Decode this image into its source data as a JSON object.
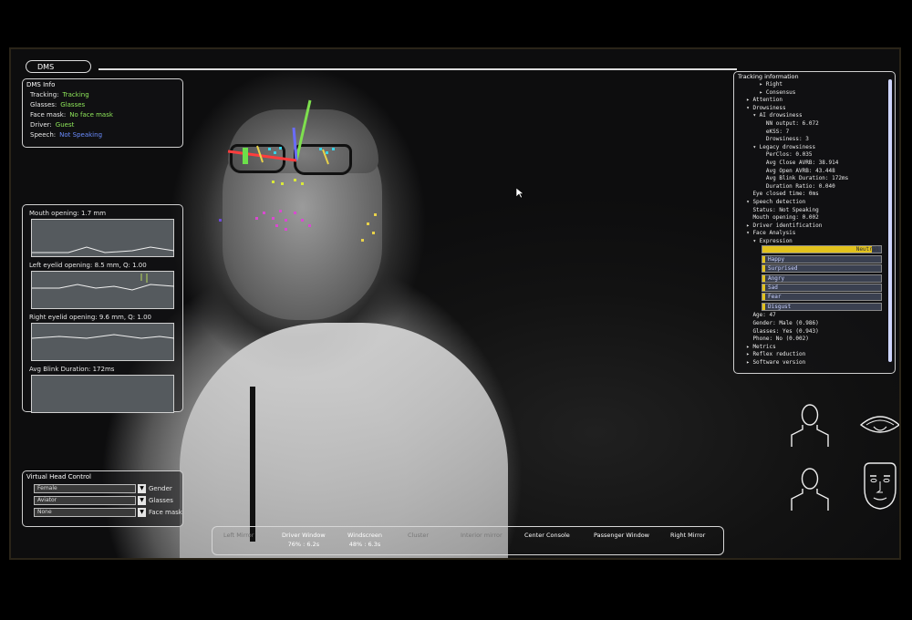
{
  "header": {
    "tab_label": "DMS"
  },
  "dms_info": {
    "title": "DMS Info",
    "rows": [
      {
        "key": "Tracking:",
        "value": "Tracking",
        "color": "#8fe85a"
      },
      {
        "key": "Glasses:",
        "value": "Glasses",
        "color": "#8fe85a"
      },
      {
        "key": "Face mask:",
        "value": "No face mask",
        "color": "#8fe85a"
      },
      {
        "key": "Driver:",
        "value": "Guest",
        "color": "#8fe85a"
      },
      {
        "key": "Speech:",
        "value": "Not Speaking",
        "color": "#6a8cff"
      }
    ]
  },
  "signals": {
    "mouth": "Mouth opening: 1.7 mm",
    "left_eyelid": "Left eyelid opening: 8.5 mm, Q: 1.00",
    "right_eyelid": "Right eyelid opening: 9.6 mm, Q: 1.00",
    "blink": "Avg Blink Duration: 172ms"
  },
  "tracking_info": {
    "title": "Tracking information",
    "rows": [
      "      ▸ Right",
      "      ▸ Consensus",
      "  ▸ Attention",
      "  ▾ Drowsiness",
      "    ▾ AI drowsiness",
      "        NN output: 6.072",
      "        eKSS: 7",
      "        Drowsiness: 3",
      "    ▾ Legacy drowsiness",
      "        PerClos: 0.035",
      "        Avg Close AVRB: 38.914",
      "        Avg Open AVRB: 43.448",
      "        Avg Blink Duration: 172ms",
      "        Duration Ratio: 0.040",
      "    Eye closed time: 0ms",
      "  ▾ Speech detection",
      "    Status: Not Speaking",
      "    Mouth opening: 0.002",
      "  ▸ Driver identification",
      "  ▾ Face Analysis",
      "    ▾ Expression"
    ],
    "expressions": [
      {
        "label": "Neutral",
        "value": 0.92
      },
      {
        "label": "Happy",
        "value": 0.02
      },
      {
        "label": "Surprised",
        "value": 0.02
      },
      {
        "label": "Angry",
        "value": 0.02
      },
      {
        "label": "Sad",
        "value": 0.02
      },
      {
        "label": "Fear",
        "value": 0.02
      },
      {
        "label": "Disgust",
        "value": 0.02
      }
    ],
    "rows_after": [
      "    Age: 47",
      "    Gender: Male (0.986)",
      "    Glasses: Yes (0.943)",
      "    Phone: No (0.002)",
      "  ▸ Metrics",
      "  ▸ Reflex reduction",
      "  ▸ Software version"
    ]
  },
  "virtual_head": {
    "title": "Virtual Head Control",
    "controls": [
      {
        "value": "Female",
        "label": "Gender"
      },
      {
        "value": "Aviator",
        "label": "Glasses"
      },
      {
        "value": "None",
        "label": "Face mask"
      }
    ]
  },
  "gaze_zones": [
    {
      "name": "Left Mirror",
      "value": "",
      "active": false
    },
    {
      "name": "Driver Window",
      "value": "76% : 6.2s",
      "active": true
    },
    {
      "name": "Windscreen",
      "value": "48% : 6.3s",
      "active": true
    },
    {
      "name": "Cluster",
      "value": "",
      "active": false
    },
    {
      "name": "Interior mirror",
      "value": "",
      "active": false
    },
    {
      "name": "Center Console",
      "value": "",
      "active": true
    },
    {
      "name": "Passenger Window",
      "value": "",
      "active": true
    },
    {
      "name": "Right Mirror",
      "value": "",
      "active": true
    }
  ],
  "colors": {
    "accent_green": "#8fe85a",
    "accent_blue": "#6a8cff",
    "expression_bar": "#e2c21d"
  }
}
